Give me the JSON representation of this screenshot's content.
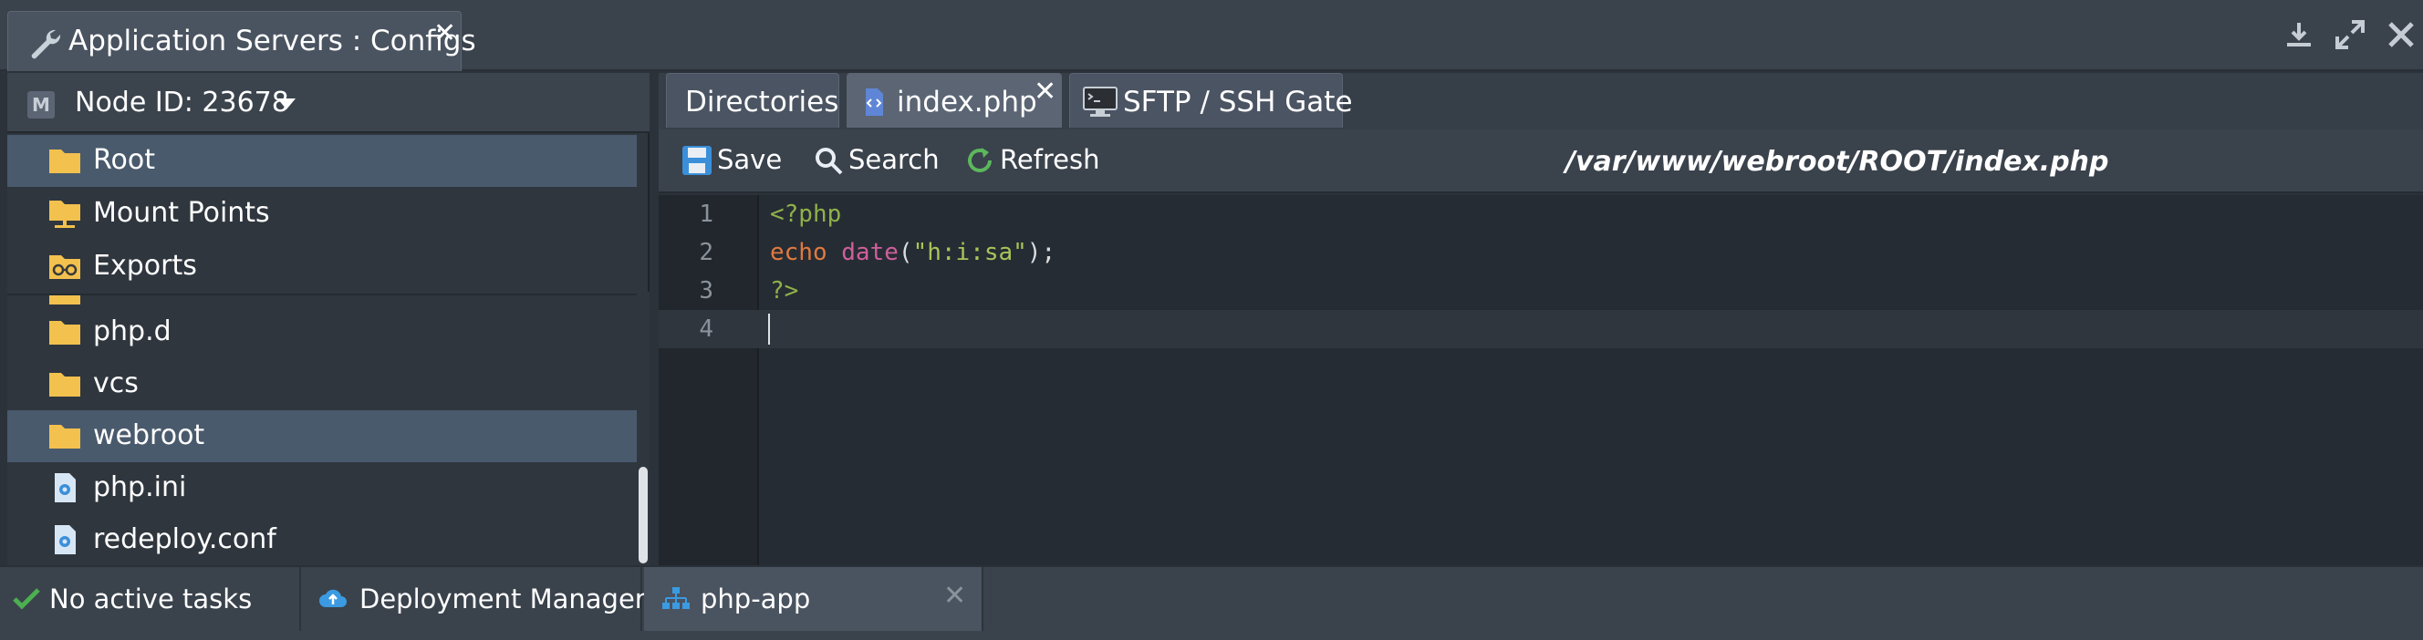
{
  "window": {
    "title": "Application Servers : Configs",
    "close": "✕"
  },
  "node": {
    "badge": "M",
    "label": "Node ID: 23678"
  },
  "tree": {
    "pinned": [
      {
        "label": "Root",
        "icon": "folder-icon",
        "selected": true
      },
      {
        "label": "Mount Points",
        "icon": "mount-folder-icon"
      },
      {
        "label": "Exports",
        "icon": "exports-folder-icon"
      }
    ],
    "items": [
      {
        "label": "php.d",
        "icon": "folder-icon"
      },
      {
        "label": "vcs",
        "icon": "folder-icon"
      },
      {
        "label": "webroot",
        "icon": "folder-icon",
        "selected": true
      },
      {
        "label": "php.ini",
        "icon": "config-file-icon"
      },
      {
        "label": "redeploy.conf",
        "icon": "config-file-icon"
      }
    ]
  },
  "tabs": [
    {
      "label": "Directories"
    },
    {
      "label": "index.php",
      "close": "✕",
      "active": true
    },
    {
      "label": "SFTP / SSH Gate"
    }
  ],
  "toolbar": {
    "save": "Save",
    "search": "Search",
    "refresh": "Refresh",
    "path": "/var/www/webroot/ROOT/index.php"
  },
  "editor": {
    "line_numbers": [
      "1",
      "2",
      "3",
      "4"
    ],
    "l1": "<?php",
    "l2_kw": "echo",
    "l2_fn": "date",
    "l2_open": "(",
    "l2_str": "\"h:i:sa\"",
    "l2_close": ");",
    "l3": "?>"
  },
  "bottom": {
    "tasks": "No active tasks",
    "deploy": "Deployment Manager",
    "app": "php-app",
    "close": "✕"
  },
  "colors": {
    "accent_green": "#4caf50",
    "cloud_blue": "#3b9ae1",
    "php_tag": "#8fb14a",
    "keyword": "#e07a40",
    "function": "#cf5f9d"
  }
}
